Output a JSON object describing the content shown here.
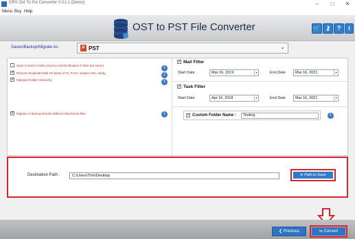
{
  "window": {
    "title": "DRS Ost To Pst Converter V-21.1 (Demo)",
    "minimize": "–",
    "maximize": "□",
    "close": "✕"
  },
  "menu": [
    "Menu",
    "Buy",
    "Help"
  ],
  "header": {
    "title": "OST to PST File Converter",
    "icons": [
      "cart-icon",
      "key-icon",
      "question-icon",
      "info-icon"
    ],
    "icon_glyphs": [
      "🛒",
      "⚷",
      "?",
      "i"
    ]
  },
  "save_as": {
    "label": "Saves/Backup/Migrate As :",
    "value": "PST",
    "badge": "P"
  },
  "options": [
    {
      "label": "Save in Same Folder (Source and Destination Folder are same)",
      "checked": false
    },
    {
      "label": "Remove Duplicate Mail On basis of To, From, Subject, Bcc, Body",
      "checked": true
    },
    {
      "label": "Maintain Folder Hierarchy",
      "checked": true
    },
    {
      "label": "Migrate or Backup Emails Without Attachment files",
      "checked": true
    }
  ],
  "mail_filter": {
    "label": "Mail Filter",
    "checked": true,
    "start_label": "Start Date",
    "start": "Mar 16, 2019",
    "end_label": "End Date",
    "end": "Mar 16, 2021"
  },
  "task_filter": {
    "label": "Task Filter",
    "checked": true,
    "start_label": "Start Date",
    "start": "Apr 16, 2018",
    "end_label": "End Date",
    "end": "Mar 16, 2021"
  },
  "custom_folder": {
    "label": "Custom Folder Name :",
    "checked": true,
    "value": "Testing"
  },
  "destination": {
    "label": "Destination Path :",
    "value": "C:\\Users\\This\\Desktop",
    "button": "Path to Save"
  },
  "footer": {
    "previous": "Previous",
    "convert": "Convert"
  },
  "colors": {
    "accent": "#2f73c4",
    "highlight": "#d8232a",
    "option_text": "#c03030"
  }
}
